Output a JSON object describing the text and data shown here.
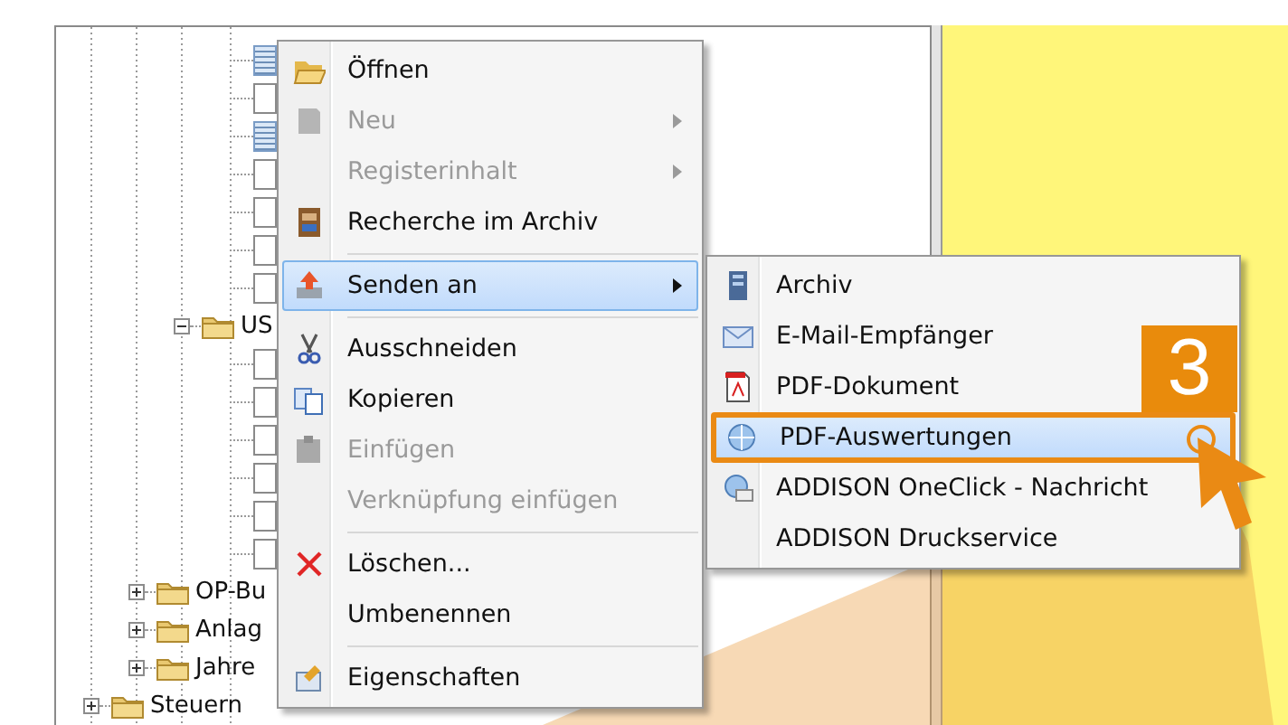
{
  "tree": {
    "nodes": [
      {
        "children": [
          {
            "children": [
              {
                "children": [
                  {
                    "kind": "doc",
                    "selected": true
                  },
                  {
                    "kind": "doc",
                    "selected": false
                  },
                  {
                    "kind": "doc",
                    "selected": true
                  },
                  {
                    "kind": "doc",
                    "selected": false
                  },
                  {
                    "kind": "doc",
                    "selected": false
                  },
                  {
                    "kind": "doc",
                    "selected": false
                  },
                  {
                    "kind": "doc",
                    "selected": false
                  }
                ]
              },
              {
                "kind": "folder",
                "label": "US",
                "expanded": true,
                "children": [
                  {
                    "kind": "doc",
                    "selected": false
                  },
                  {
                    "kind": "doc",
                    "selected": false
                  },
                  {
                    "kind": "doc",
                    "selected": false
                  },
                  {
                    "kind": "doc",
                    "selected": false
                  },
                  {
                    "kind": "doc",
                    "selected": false
                  },
                  {
                    "kind": "doc",
                    "selected": false
                  }
                ]
              }
            ]
          },
          {
            "kind": "folder",
            "label": "OP-Bu",
            "expanded": false
          },
          {
            "kind": "folder",
            "label": "Anlag",
            "expanded": false
          },
          {
            "kind": "folder",
            "label": "Jahre",
            "expanded": false
          }
        ]
      },
      {
        "kind": "folder",
        "label": "Steuern",
        "expanded": false
      }
    ]
  },
  "context_menu": {
    "items": [
      {
        "kind": "item",
        "label": "Öffnen",
        "disabled": false,
        "submenu": false,
        "selected": false
      },
      {
        "kind": "item",
        "label": "Neu",
        "disabled": true,
        "submenu": true,
        "selected": false
      },
      {
        "kind": "item",
        "label": "Registerinhalt",
        "disabled": true,
        "submenu": true,
        "selected": false
      },
      {
        "kind": "item",
        "label": "Recherche im Archiv",
        "disabled": false,
        "submenu": false,
        "selected": false
      },
      {
        "kind": "separator"
      },
      {
        "kind": "item",
        "label": "Senden an",
        "disabled": false,
        "submenu": true,
        "selected": true
      },
      {
        "kind": "separator"
      },
      {
        "kind": "item",
        "label": "Ausschneiden",
        "disabled": false,
        "submenu": false,
        "selected": false
      },
      {
        "kind": "item",
        "label": "Kopieren",
        "disabled": false,
        "submenu": false,
        "selected": false
      },
      {
        "kind": "item",
        "label": "Einfügen",
        "disabled": true,
        "submenu": false,
        "selected": false
      },
      {
        "kind": "item",
        "label": "Verknüpfung einfügen",
        "disabled": true,
        "submenu": false,
        "selected": false
      },
      {
        "kind": "separator"
      },
      {
        "kind": "item",
        "label": "Löschen...",
        "disabled": false,
        "submenu": false,
        "selected": false
      },
      {
        "kind": "item",
        "label": "Umbenennen",
        "disabled": false,
        "submenu": false,
        "selected": false
      },
      {
        "kind": "separator"
      },
      {
        "kind": "item",
        "label": "Eigenschaften",
        "disabled": false,
        "submenu": false,
        "selected": false
      }
    ]
  },
  "submenu": {
    "items": [
      {
        "label": "Archiv",
        "selected": false
      },
      {
        "label": "E-Mail-Empfänger",
        "selected": false
      },
      {
        "label": "PDF-Dokument",
        "selected": false
      },
      {
        "label": "PDF-Auswertungen",
        "selected": true
      },
      {
        "label": "ADDISON OneClick - Nachricht",
        "selected": false
      },
      {
        "label": "ADDISON Druckservice",
        "selected": false
      }
    ]
  },
  "step_badge": "3"
}
